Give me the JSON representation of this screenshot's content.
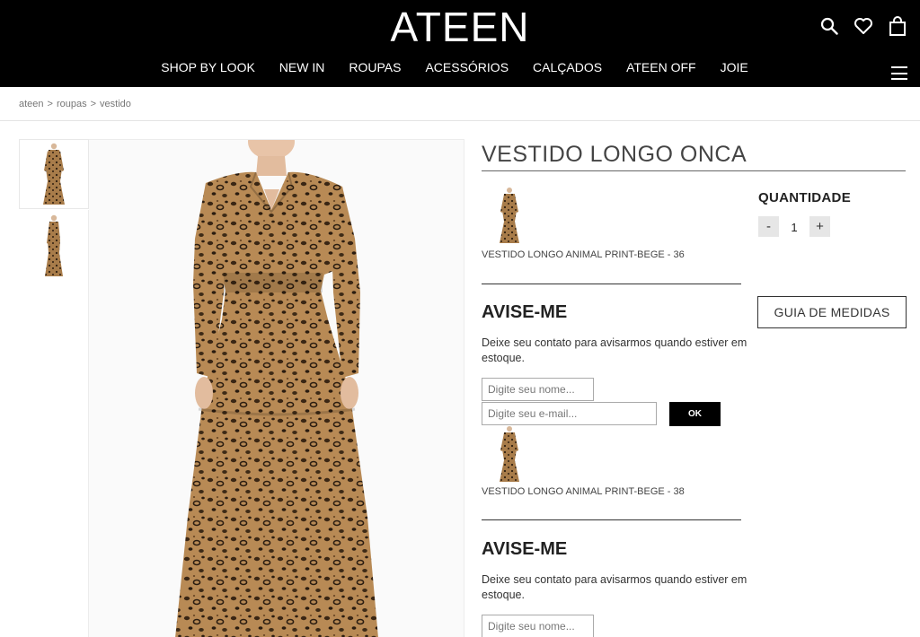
{
  "header": {
    "logo": "ATEEN",
    "nav": [
      "SHOP BY LOOK",
      "NEW IN",
      "ROUPAS",
      "ACESSÓRIOS",
      "CALÇADOS",
      "ATEEN OFF",
      "JOIE"
    ],
    "icons": [
      "search-icon",
      "heart-icon",
      "bag-icon",
      "menu-icon"
    ]
  },
  "breadcrumb": [
    "ateen",
    "roupas",
    "vestido"
  ],
  "breadcrumb_sep": ">",
  "product": {
    "title": "VESTIDO LONGO ONCA",
    "quantity_label": "QUANTIDADE",
    "quantity_value": "1",
    "minus": "-",
    "plus": "+",
    "size_guide": "GUIA DE MEDIDAS"
  },
  "variants": [
    {
      "label": "VESTIDO LONGO ANIMAL PRINT-BEGE - 36",
      "notify_title": "AVISE-ME",
      "notify_text": "Deixe seu contato para avisarmos quando estiver em estoque.",
      "name_placeholder": "Digite seu nome...",
      "email_placeholder": "Digite seu e-mail...",
      "ok_label": "OK"
    },
    {
      "label": "VESTIDO LONGO ANIMAL PRINT-BEGE - 38",
      "notify_title": "AVISE-ME",
      "notify_text": "Deixe seu contato para avisarmos quando estiver em estoque.",
      "name_placeholder": "Digite seu nome..."
    }
  ],
  "colors": {
    "header_bg": "#000000",
    "print_base": "#b88a55",
    "print_spot": "#2a1c10"
  }
}
